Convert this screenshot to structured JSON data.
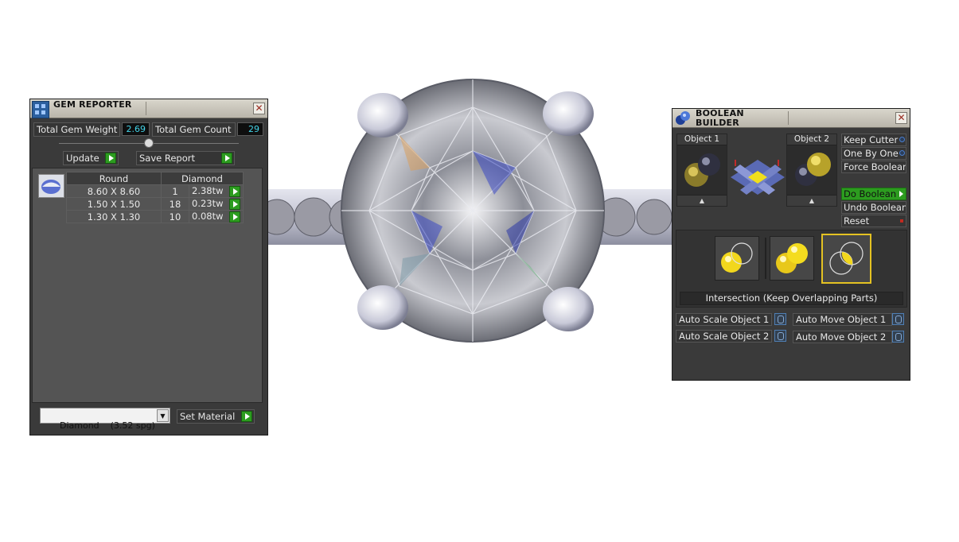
{
  "gem_reporter": {
    "title": "GEM REPORTER",
    "total_weight_label": "Total Gem Weight",
    "total_weight_value": "2.69",
    "total_count_label": "Total Gem Count",
    "total_count_value": "29",
    "update_label": "Update",
    "save_report_label": "Save Report",
    "table": {
      "headers": [
        "Round",
        "Diamond"
      ],
      "rows": [
        {
          "size": "8.60 X 8.60",
          "count": "1",
          "weight": "2.38tw"
        },
        {
          "size": "1.50 X 1.50",
          "count": "18",
          "weight": "0.23tw"
        },
        {
          "size": "1.30 X 1.30",
          "count": "10",
          "weight": "0.08tw"
        }
      ]
    },
    "material_select": "Diamond    (3.52 spg)",
    "set_material_label": "Set Material"
  },
  "boolean_builder": {
    "title_line1": "BOOLEAN",
    "title_line2": "BUILDER",
    "object1_label": "Object 1",
    "object2_label": "Object 2",
    "options": {
      "keep_cutter": "Keep Cutter",
      "one_by_one": "One By One",
      "force_boolean": "Force Boolear",
      "do_boolean": "Do Boolean",
      "undo_boolean": "Undo Boolean",
      "reset": "Reset"
    },
    "mode_caption": "Intersection (Keep Overlapping Parts)",
    "auto_scale_1": "Auto Scale Object 1",
    "auto_scale_2": "Auto Scale Object 2",
    "auto_move_1": "Auto Move Object 1",
    "auto_move_2": "Auto Move Object 2"
  },
  "colors": {
    "panel_bg": "#3a3a3a",
    "value_text": "#44d4e8",
    "green_button": "#2c9c1f",
    "selected_mode": "#e4c222"
  }
}
